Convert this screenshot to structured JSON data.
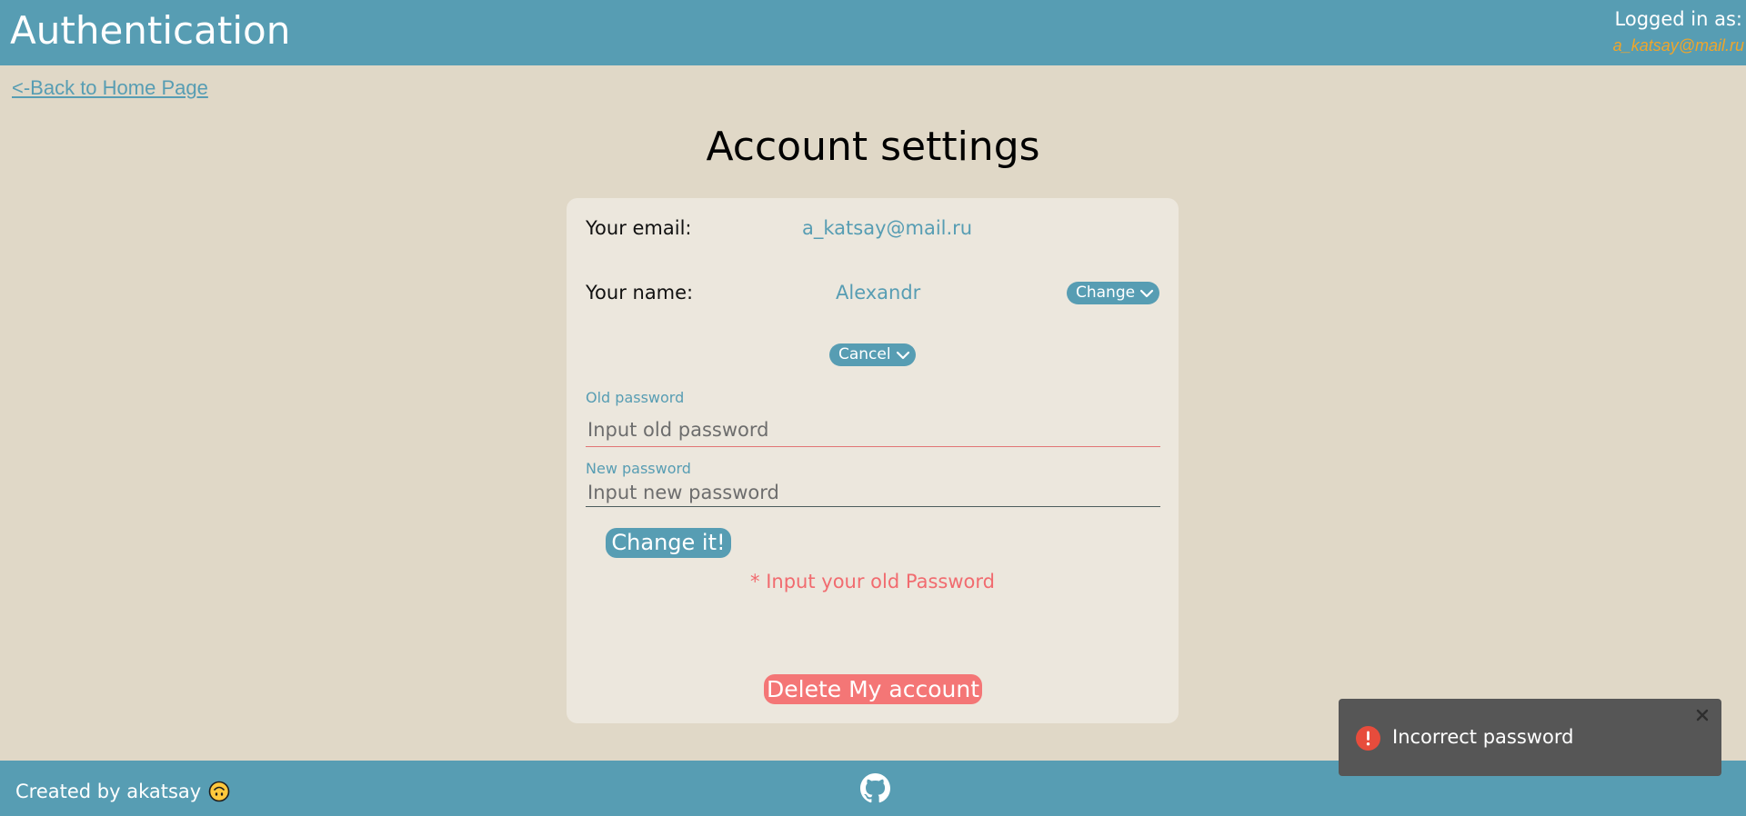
{
  "header": {
    "title": "Authentication",
    "logged_in_label": "Logged in as:",
    "logged_in_email": "a_katsay@mail.ru"
  },
  "nav": {
    "back_link": "<-Back to Home Page"
  },
  "page": {
    "title": "Account settings"
  },
  "account": {
    "email_label": "Your email:",
    "email_value": "a_katsay@mail.ru",
    "name_label": "Your name:",
    "name_value": "Alexandr",
    "change_label": "Change",
    "cancel_label": "Cancel"
  },
  "password_form": {
    "old_label": "Old password",
    "old_placeholder": "Input old password",
    "old_value": "",
    "new_label": "New password",
    "new_placeholder": "Input new password",
    "new_value": "",
    "submit_label": "Change it!",
    "error": "* Input your old Password"
  },
  "danger": {
    "delete_label": "Delete My account"
  },
  "footer": {
    "credit": "Created by akatsay",
    "emoji_icon": "upside-down-face-icon",
    "link_icon": "github-icon"
  },
  "toast": {
    "message": "Incorrect password",
    "icon": "error-icon",
    "close_icon": "close-icon"
  },
  "colors": {
    "primary": "#579db3",
    "background": "#e0d8c7",
    "card": "#ece7dd",
    "error": "#f16b6f",
    "danger": "#f47676",
    "accent_email": "#f0a52a",
    "toast_bg": "#565656"
  }
}
